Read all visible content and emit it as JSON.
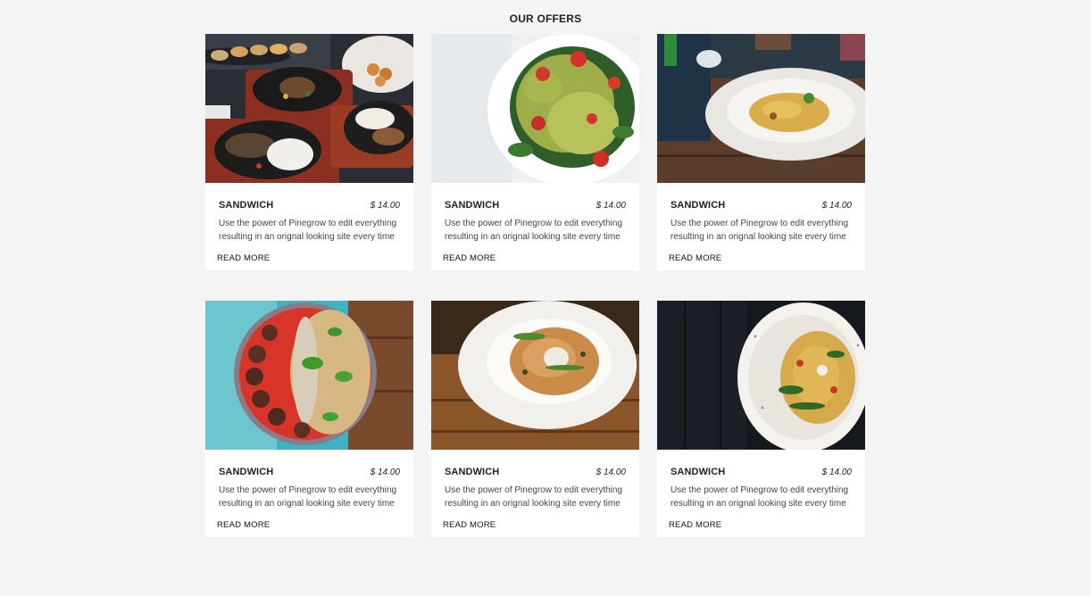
{
  "section": {
    "title": "OUR OFFERS"
  },
  "cards": [
    {
      "name": "SANDWICH",
      "price": "$ 14.00",
      "description": "Use the power of Pinegrow to edit everything resulting in an orignal looking site every time",
      "link": "READ MORE",
      "image": "platter-photo"
    },
    {
      "name": "SANDWICH",
      "price": "$ 14.00",
      "description": "Use the power of Pinegrow to edit everything resulting in an orignal looking site every time",
      "link": "READ MORE",
      "image": "pasta-salad-photo"
    },
    {
      "name": "SANDWICH",
      "price": "$ 14.00",
      "description": "Use the power of Pinegrow to edit everything resulting in an orignal looking site every time",
      "link": "READ MORE",
      "image": "tagliatelle-photo"
    },
    {
      "name": "SANDWICH",
      "price": "$ 14.00",
      "description": "Use the power of Pinegrow to edit everything resulting in an orignal looking site every time",
      "link": "READ MORE",
      "image": "penne-meatballs-photo"
    },
    {
      "name": "SANDWICH",
      "price": "$ 14.00",
      "description": "Use the power of Pinegrow to edit everything resulting in an orignal looking site every time",
      "link": "READ MORE",
      "image": "spaghetti-photo"
    },
    {
      "name": "SANDWICH",
      "price": "$ 14.00",
      "description": "Use the power of Pinegrow to edit everything resulting in an orignal looking site every time",
      "link": "READ MORE",
      "image": "spaghetti-dark-photo"
    }
  ]
}
